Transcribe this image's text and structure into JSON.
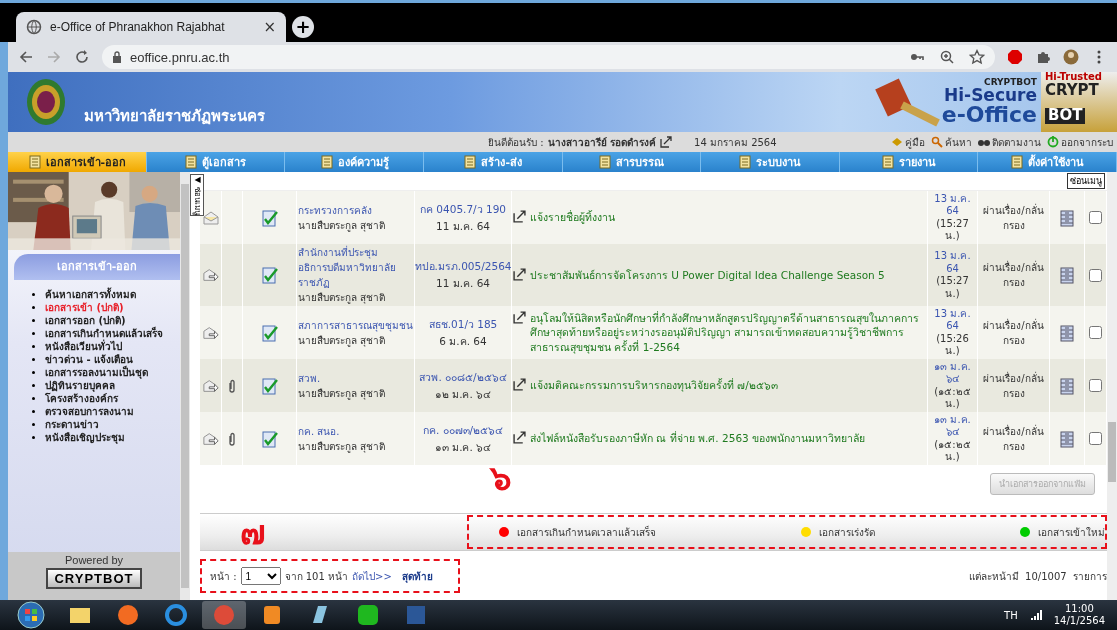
{
  "browser": {
    "tab_title": "e-Office of Phranakhon Rajabhat",
    "tab_close": "×",
    "new_tab": "+",
    "url": "eoffice.pnru.ac.th"
  },
  "header": {
    "university": "มหาวิทยาลัยราชภัฏพระนคร",
    "brand": [
      "CRYPTBOT",
      "Hi-Secure",
      "e-Office"
    ],
    "brand2": [
      "Hi-Trusted",
      "CRYPT",
      "BOT"
    ],
    "welcome_label": "ยินดีต้อนรับ :",
    "user": "นางสาวอารีย์ รอดดำรงค์",
    "date": "14 มกราคม 2564",
    "links": [
      {
        "kind": "manual",
        "label": "คู่มือ"
      },
      {
        "kind": "search",
        "label": "ค้นหา"
      },
      {
        "kind": "track",
        "label": "ติดตามงาน"
      },
      {
        "kind": "logout",
        "label": "ออกจากระบ"
      }
    ]
  },
  "nav": [
    {
      "label": "เอกสารเข้า-ออก",
      "selected": true
    },
    {
      "label": "ตู้เอกสาร",
      "selected": false
    },
    {
      "label": "องค์ความรู้",
      "selected": false
    },
    {
      "label": "สร้าง-ส่ง",
      "selected": false
    },
    {
      "label": "สารบรรณ",
      "selected": false
    },
    {
      "label": "ระบบงาน",
      "selected": false
    },
    {
      "label": "รายงาน",
      "selected": false
    },
    {
      "label": "ตั้งค่าใช้งาน",
      "selected": false
    }
  ],
  "tooltip": "ซ่อนเมนู",
  "sidebar": {
    "title": "เอกสารเข้า-ออก",
    "items": [
      {
        "label": "ค้นหาเอกสารทั้งหมด",
        "selected": false
      },
      {
        "label": "เอกสารเข้า (ปกติ)",
        "selected": true
      },
      {
        "label": "เอกสารออก (ปกติ)",
        "selected": false
      },
      {
        "label": "เอกสารเกินกำหนดแล้วเสร็จ",
        "selected": false
      },
      {
        "label": "หนังสือเวียนทั่วไป",
        "selected": false
      },
      {
        "label": "ข่าวด่วน - แจ้งเตือน",
        "selected": false
      },
      {
        "label": "เอกสารรอลงนามเป็นชุด",
        "selected": false
      },
      {
        "label": "ปฏิทินรายบุคคล",
        "selected": false
      },
      {
        "label": "โครงสร้างองค์กร",
        "selected": false
      },
      {
        "label": "ตรวจสอบการลงนาม",
        "selected": false
      },
      {
        "label": "กระดานข่าว",
        "selected": false
      },
      {
        "label": "หนังสือเชิญประชุม",
        "selected": false
      }
    ],
    "powered_by": "Powered by",
    "badge": "CRYPTBOT"
  },
  "hide_menu_tab": {
    "arrow": "◀",
    "label": "ซ่อนเมนู"
  },
  "table": {
    "rows": [
      {
        "kind": "read",
        "attachment": false,
        "from": "กระทรวงการคลัง",
        "person": "นายสืบตระกูล สุชาติ",
        "doc_no": "กค 0405.7/ว 190",
        "doc_date": "11 ม.ค. 64",
        "subject": "แจ้งรายชื่อผู้ทิ้งงาน",
        "date": "13 ม.ค. 64",
        "time": "(15:27 น.)",
        "status": "ผ่านเรื่อง/กลั่นกรอง",
        "checked": false
      },
      {
        "kind": "forward",
        "attachment": false,
        "from": "สำนักงานที่ประชุมอธิการบดีมหาวิทยาลัยราชภัฏ",
        "person": "นายสืบตระกูล สุชาติ",
        "doc_no": "ทปอ.มรภ.005/2564",
        "doc_date": "11 ม.ค. 64",
        "subject": "ประชาสัมพันธ์การจัดโครงการ U Power Digital Idea Challenge Season 5",
        "date": "13 ม.ค. 64",
        "time": "(15:27 น.)",
        "status": "ผ่านเรื่อง/กลั่นกรอง",
        "checked": false
      },
      {
        "kind": "forward",
        "attachment": false,
        "from": "สภาการสาธารณสุขชุมชน",
        "person": "นายสืบตระกูล สุชาติ",
        "doc_no": "สธช.01/ว 185",
        "doc_date": "6 ม.ค. 64",
        "subject": "อนุโลมให้นิสิตหรือนักศึกษาที่กำลังศึกษาหลักสูตรปริญญาตรีด้านสาธารณสุขในภาคการศึกษาสุดท้ายหรืออยู่ระหว่างรออนุมัติปริญญา สามารถเข้าทดสอบความรู้วิชาชีพการสาธารณสุขชุมชน ครั้งที่ 1-2564",
        "date": "13 ม.ค. 64",
        "time": "(15:26 น.)",
        "status": "ผ่านเรื่อง/กลั่นกรอง",
        "checked": false
      },
      {
        "kind": "forward",
        "attachment": true,
        "from": "สวพ.",
        "person": "นายสืบตระกูล สุชาติ",
        "doc_no": "สวพ. ๐๐๘๕/๒๕๖๔",
        "doc_date": "๑๒ ม.ค. ๖๔",
        "subject": "แจ้งมติคณะกรรมการบริหารกองทุนวิจัยครั้งที่ ๗/๒๕๖๓",
        "date": "๑๓ ม.ค. ๖๔",
        "time": "(๑๕:๒๕ น.)",
        "status": "ผ่านเรื่อง/กลั่นกรอง",
        "checked": false
      },
      {
        "kind": "forward",
        "attachment": true,
        "from": "กค. สนอ.",
        "person": "นายสืบตระกูล สุชาติ",
        "doc_no": "กค. ๐๐๗๓/๒๕๖๔",
        "doc_date": "๑๓ ม.ค. ๖๔",
        "subject": "ส่งไฟล์หนังสือรับรองภาษีหัก ณ ที่จ่าย พ.ศ. 2563 ของพนักงานมหาวิทยาลัย",
        "date": "๑๓ ม.ค. ๖๔",
        "time": "(๑๕:๒๕ น.)",
        "status": "ผ่านเรื่อง/กลั่นกรอง",
        "checked": false
      }
    ]
  },
  "remove_button": {
    "label": "นำเอกสารออกจากแฟ้ม",
    "disabled": true
  },
  "annotations": [
    "๖",
    "๗"
  ],
  "legend": [
    {
      "label": "เอกสารเกินกำหนดเวลาแล้วเสร็จ",
      "color": "#ff0000"
    },
    {
      "label": "เอกสารเร่งรัด",
      "color": "#ffdd00"
    },
    {
      "label": "เอกสารเข้าใหม่",
      "color": "#00cc00"
    }
  ],
  "pager": {
    "label": "หน้า :",
    "page": "1",
    "of": "จาก 101 หน้า",
    "next": "ถัดไป>>",
    "last": "สุดท้าย",
    "per_page": "แต่ละหน้ามี  10/1007  รายการ"
  },
  "taskbar": {
    "lang": "TH",
    "time": "11:00",
    "date": "14/1/2564"
  }
}
